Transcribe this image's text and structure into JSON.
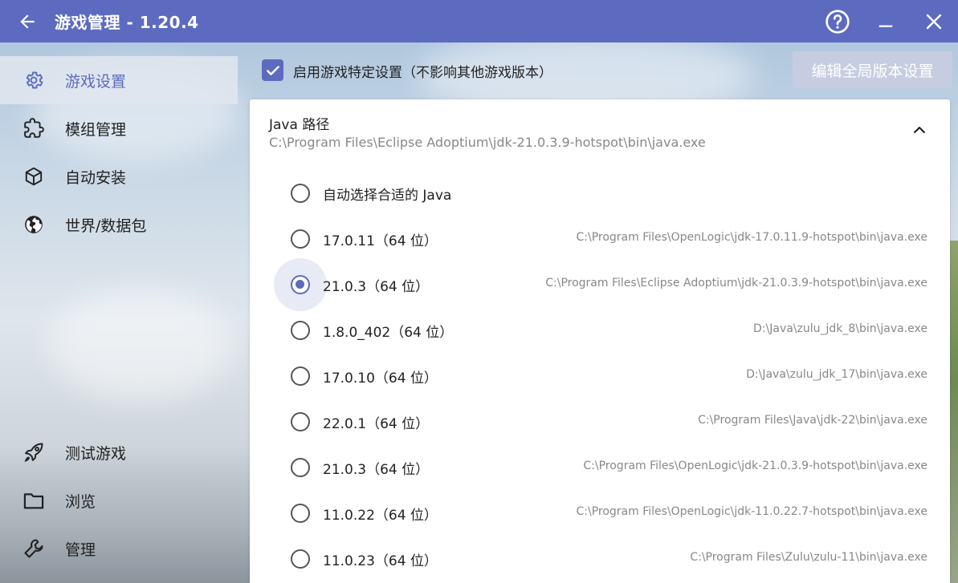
{
  "titlebar": {
    "title": "游戏管理 - 1.20.4"
  },
  "sidebar": {
    "items": [
      {
        "label": "游戏设置",
        "icon": "gear-icon"
      },
      {
        "label": "模组管理",
        "icon": "puzzle-icon"
      },
      {
        "label": "自动安装",
        "icon": "cube-icon"
      },
      {
        "label": "世界/数据包",
        "icon": "globe-icon"
      }
    ],
    "bottom_items": [
      {
        "label": "测试游戏",
        "icon": "rocket-icon"
      },
      {
        "label": "浏览",
        "icon": "folder-icon"
      },
      {
        "label": "管理",
        "icon": "wrench-icon"
      }
    ]
  },
  "settings": {
    "enable_specific_label": "启用游戏特定设置（不影响其他游戏版本）",
    "edit_global_label": "编辑全局版本设置"
  },
  "java_panel": {
    "title": "Java 路径",
    "current_path": "C:\\Program Files\\Eclipse Adoptium\\jdk-21.0.3.9-hotspot\\bin\\java.exe",
    "options": [
      {
        "label": "自动选择合适的 Java",
        "path": ""
      },
      {
        "label": "17.0.11（64 位）",
        "path": "C:\\Program Files\\OpenLogic\\jdk-17.0.11.9-hotspot\\bin\\java.exe"
      },
      {
        "label": "21.0.3（64 位）",
        "path": "C:\\Program Files\\Eclipse Adoptium\\jdk-21.0.3.9-hotspot\\bin\\java.exe"
      },
      {
        "label": "1.8.0_402（64 位）",
        "path": "D:\\Java\\zulu_jdk_8\\bin\\java.exe"
      },
      {
        "label": "17.0.10（64 位）",
        "path": "D:\\Java\\zulu_jdk_17\\bin\\java.exe"
      },
      {
        "label": "22.0.1（64 位）",
        "path": "C:\\Program Files\\Java\\jdk-22\\bin\\java.exe"
      },
      {
        "label": "21.0.3（64 位）",
        "path": "C:\\Program Files\\OpenLogic\\jdk-21.0.3.9-hotspot\\bin\\java.exe"
      },
      {
        "label": "11.0.22（64 位）",
        "path": "C:\\Program Files\\OpenLogic\\jdk-11.0.22.7-hotspot\\bin\\java.exe"
      },
      {
        "label": "11.0.23（64 位）",
        "path": "C:\\Program Files\\Zulu\\zulu-11\\bin\\java.exe"
      }
    ]
  },
  "colors": {
    "accent": "#5c6bc0"
  }
}
